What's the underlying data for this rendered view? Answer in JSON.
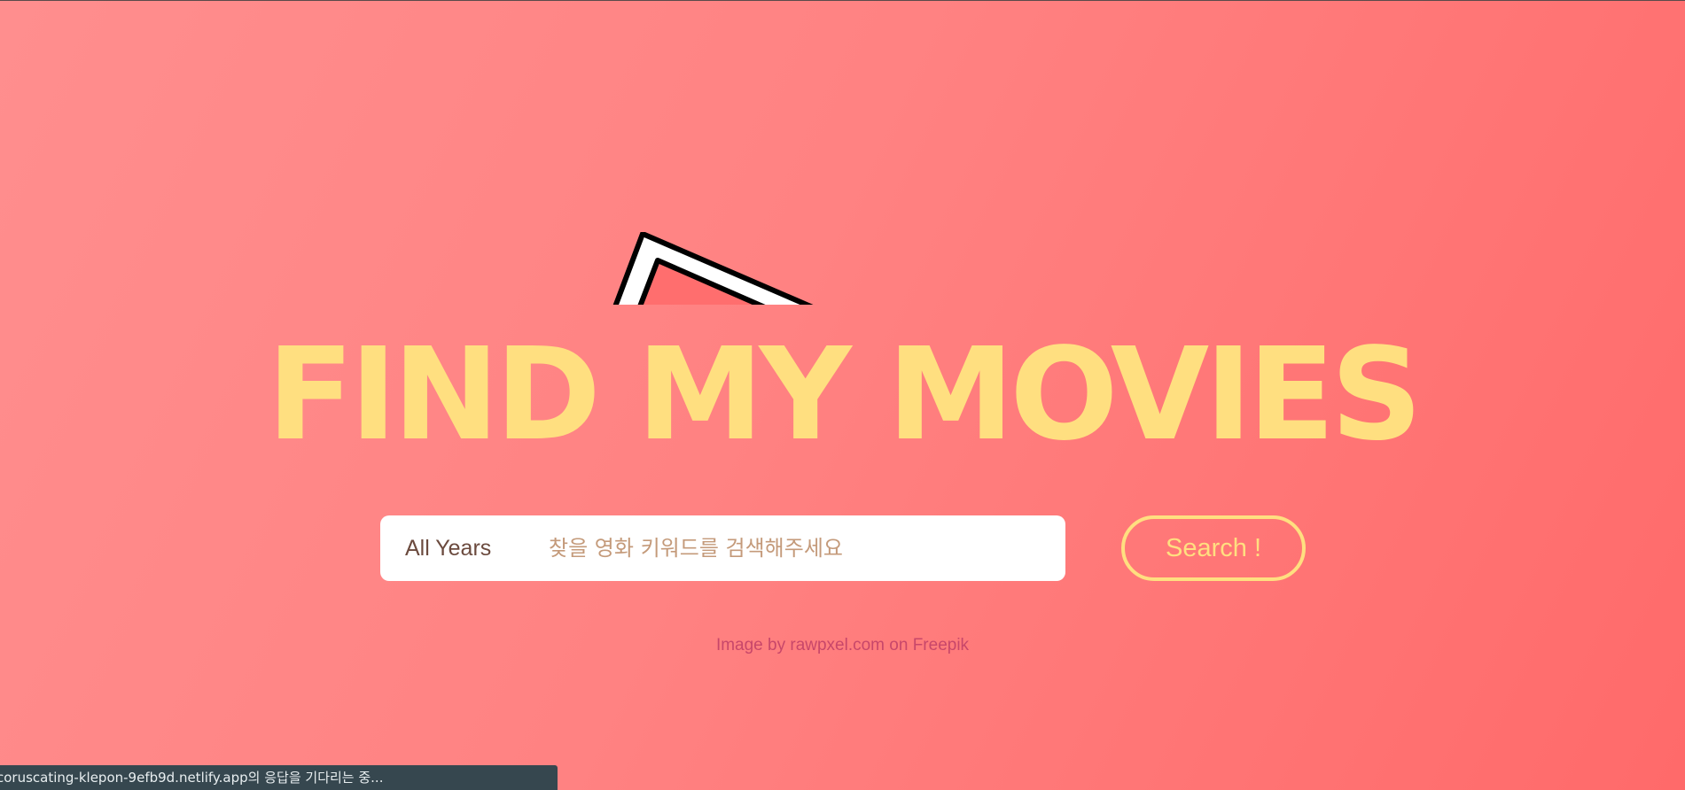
{
  "page": {
    "title": "FIND MY MOVIES"
  },
  "search": {
    "year_selected": "All Years",
    "placeholder": "찾을 영화 키워드를 검색해주세요",
    "button_label": "Search !"
  },
  "credit": {
    "text": "Image by rawpxel.com on Freepik"
  },
  "status_bar": {
    "text": "coruscating-klepon-9efb9d.netlify.app의 응답을 기다리는 중..."
  },
  "colors": {
    "background_start": "#ff8e8e",
    "background_end": "#ff6a6a",
    "title": "#ffdf80",
    "button_border": "#ffdf80",
    "credit_text": "#c8476a",
    "status_bar_bg": "#36474f"
  },
  "icons": {
    "illustration": "ticket-illustration"
  }
}
